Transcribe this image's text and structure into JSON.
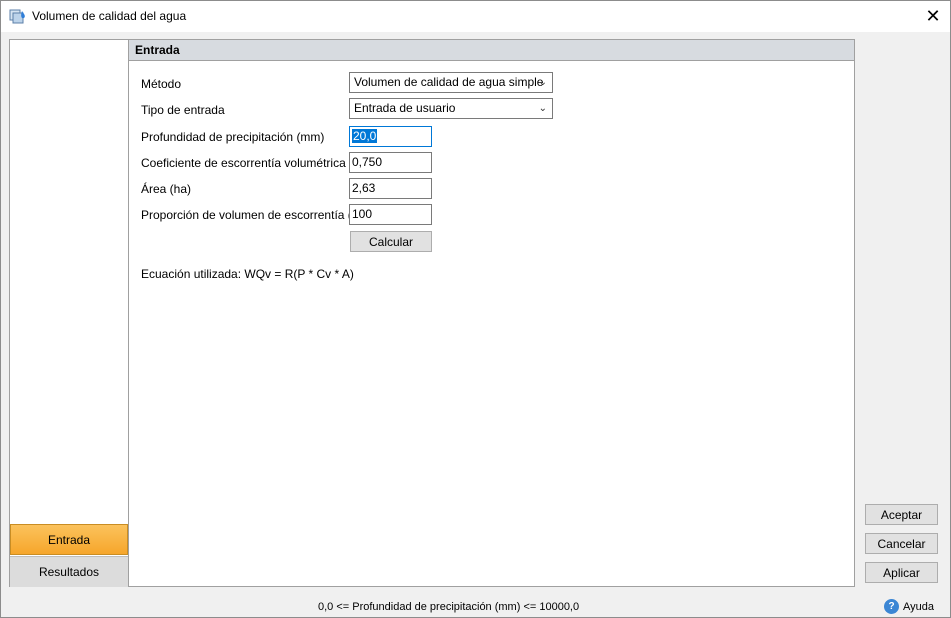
{
  "window": {
    "title": "Volumen de calidad del agua",
    "close_glyph": "✕",
    "icon": "water-quality-icon"
  },
  "nav": {
    "items": [
      {
        "label": "Entrada",
        "active": true
      },
      {
        "label": "Resultados",
        "active": false
      }
    ]
  },
  "panel": {
    "header": "Entrada",
    "fields": {
      "method": {
        "label": "Método",
        "value": "Volumen de calidad de agua simple"
      },
      "input_type": {
        "label": "Tipo de entrada",
        "value": "Entrada de usuario"
      },
      "precip_depth": {
        "label": "Profundidad de precipitación (mm)",
        "value": "20,0"
      },
      "runoff_coef": {
        "label": "Coeficiente de escorrentía volumétrica",
        "value": "0,750"
      },
      "area": {
        "label": "Área (ha)",
        "value": "2,63"
      },
      "runoff_ratio": {
        "label": "Proporción de volumen de escorrentía (%)",
        "value": "100"
      }
    },
    "calculate_label": "Calcular",
    "equation": "Ecuación utilizada: WQv = R(P * Cv * A)"
  },
  "buttons": {
    "accept": "Aceptar",
    "cancel": "Cancelar",
    "apply": "Aplicar"
  },
  "status": {
    "constraint": "0,0 <= Profundidad de precipitación (mm) <= 10000,0",
    "help_label": "Ayuda"
  },
  "colors": {
    "active_tab": "#f6a62b",
    "selection": "#0078d7",
    "header_bg": "#d7dbe0"
  }
}
